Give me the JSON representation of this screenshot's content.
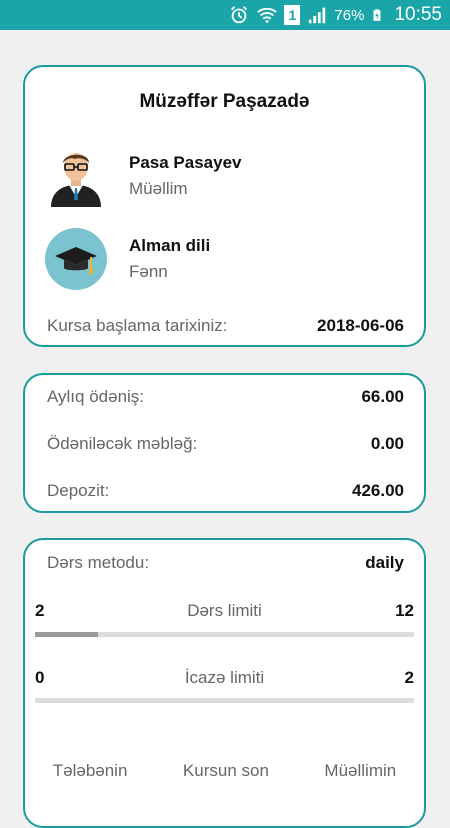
{
  "status_bar": {
    "battery": "76%",
    "time": "10:55",
    "sim": "1",
    "icons": [
      "alarm-icon",
      "wifi-icon",
      "sim-icon",
      "signal-icon",
      "battery-charging-icon"
    ]
  },
  "course": {
    "student_name": "Müzəffər Paşazadə",
    "teacher": {
      "name": "Pasa Pasayev",
      "role": "Müəllim",
      "icon": "teacher-avatar-icon"
    },
    "subject": {
      "name": "Alman dili",
      "role": "Fənn",
      "icon": "graduation-cap-icon"
    },
    "start_date_label": "Kursa başlama tarixiniz:",
    "start_date_value": "2018-06-06"
  },
  "payments": {
    "monthly_label": "Aylıq ödəniş:",
    "monthly_value": "66.00",
    "due_label": "Ödəniləcək məbləğ:",
    "due_value": "0.00",
    "deposit_label": "Depozit:",
    "deposit_value": "426.00"
  },
  "limits": {
    "method_label": "Dərs metodu:",
    "method_value": "daily",
    "lesson_limit": {
      "label": "Dərs limiti",
      "used": "2",
      "total": "12",
      "fill_fraction": 0.167
    },
    "leave_limit": {
      "label": "İcazə limiti",
      "used": "0",
      "total": "2",
      "fill_fraction": 0
    },
    "bottom_cols": [
      "Tələbənin",
      "Kursun son",
      "Müəllimin"
    ]
  },
  "colors": {
    "accent": "#1aa6a8",
    "card_border": "#1b9aa0",
    "bar_fill": "#999999",
    "bar_track": "#dcdcdc"
  }
}
